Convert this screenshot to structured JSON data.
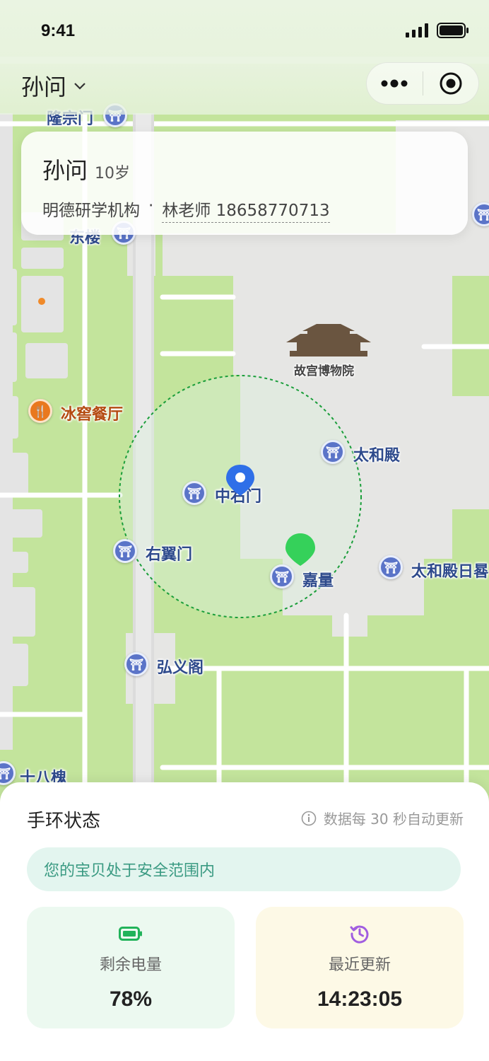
{
  "status_bar": {
    "time": "9:41"
  },
  "nav": {
    "title": "孙问",
    "more_icon": "more-dots-icon",
    "close_icon": "target-circle-icon"
  },
  "child": {
    "name": "孙问",
    "age": "10岁",
    "organization": "明德研学机构",
    "separator": "·",
    "teacher_contact": "林老师 18658770713"
  },
  "map": {
    "labels": {
      "longzong": "隆宗门",
      "jinglou": "东楼",
      "bingjiao": "冰窖餐厅",
      "palace_museum": "故宫博物院",
      "taihe": "太和殿",
      "zhongyou": "中右门",
      "youyi": "右翼门",
      "jialiang": "嘉量",
      "taihe_sundial": "太和殿日晷",
      "hongyi": "弘义阁",
      "shiba": "十八槐"
    },
    "safe_zone_color": "#1a9e3a",
    "child_marker_color": "#2f6fe8",
    "target_marker_color": "#35d15a"
  },
  "sheet": {
    "title": "手环状态",
    "update_note": "数据每 30 秒自动更新",
    "safe_message": "您的宝贝处于安全范围内",
    "battery": {
      "label": "剩余电量",
      "value": "78%",
      "icon": "battery-icon",
      "color": "#21b35a"
    },
    "last_update": {
      "label": "最近更新",
      "value": "14:23:05",
      "icon": "history-icon",
      "color": "#a15ee0"
    }
  }
}
